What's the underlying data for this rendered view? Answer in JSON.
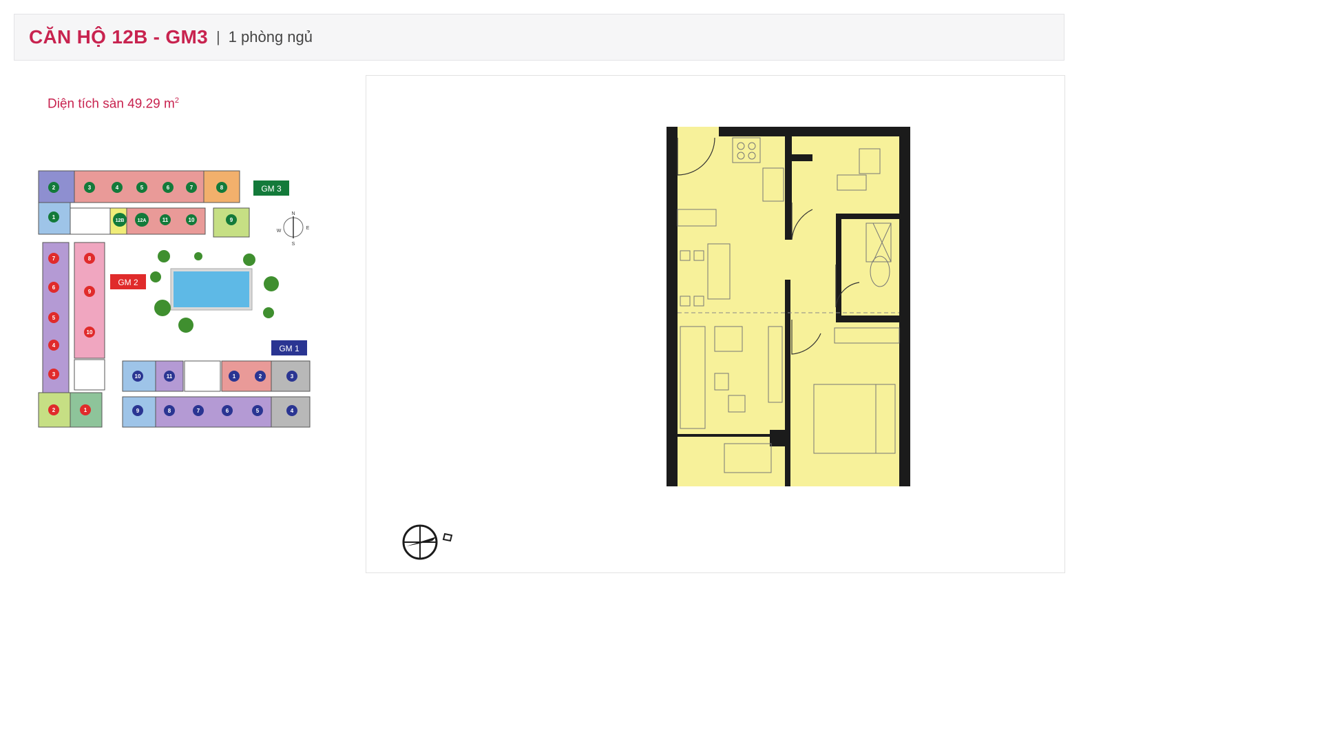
{
  "header": {
    "title": "CĂN HỘ 12B - GM3",
    "separator": "|",
    "subtitle": "1 phòng ngủ"
  },
  "area": {
    "label": "Diện tích sàn 49.29 m",
    "unit_exp": "2"
  },
  "site_plan": {
    "blocks": [
      {
        "name": "GM 3",
        "color": "#137a3a"
      },
      {
        "name": "GM 2",
        "color": "#e02b2b"
      },
      {
        "name": "GM 1",
        "color": "#2a3592"
      }
    ],
    "gm3_units": [
      "2",
      "3",
      "4",
      "5",
      "6",
      "7",
      "8",
      "1",
      "12B",
      "12A",
      "11",
      "10",
      "9"
    ],
    "gm2_units": [
      "7",
      "8",
      "6",
      "9",
      "5",
      "10",
      "4",
      "3",
      "2",
      "1"
    ],
    "gm1_units": [
      "10",
      "11",
      "1",
      "2",
      "3",
      "9",
      "8",
      "7",
      "6",
      "5",
      "4"
    ],
    "compass": {
      "n": "N",
      "s": "S",
      "e": "E",
      "w": "W"
    }
  },
  "colors": {
    "accent": "#c8234f",
    "plan_fill": "#f7f19a",
    "wall": "#1b1b1b"
  }
}
